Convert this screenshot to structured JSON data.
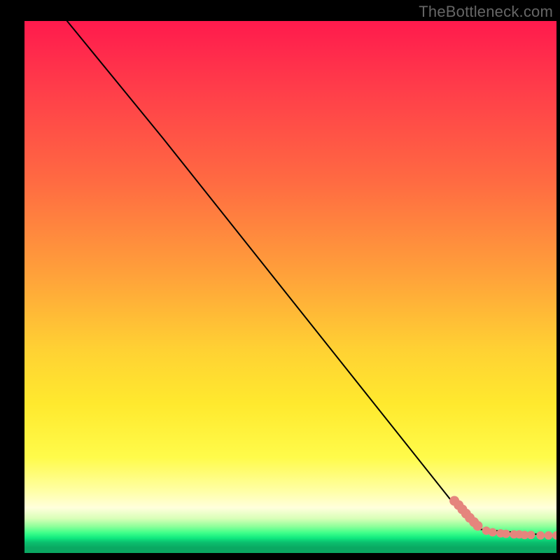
{
  "watermark": "TheBottleneck.com",
  "chart_data": {
    "type": "line",
    "title": "",
    "xlabel": "",
    "ylabel": "",
    "xlim": [
      0,
      100
    ],
    "ylim": [
      0,
      100
    ],
    "grid": false,
    "line": {
      "x": [
        8,
        26,
        80.5,
        85,
        100
      ],
      "y": [
        100,
        78,
        9.5,
        4.5,
        3.2
      ],
      "stroke": "#000000",
      "width": 2
    },
    "series": [
      {
        "name": "points-a",
        "type": "scatter",
        "color": "#e5857d",
        "radius": 7,
        "x": [
          80.8,
          81.6,
          82.3,
          83.0,
          83.7,
          84.5,
          85.2
        ],
        "y": [
          9.8,
          9.0,
          8.2,
          7.4,
          6.6,
          5.8,
          5.1
        ]
      },
      {
        "name": "points-b",
        "type": "scatter",
        "color": "#e5857d",
        "radius": 6,
        "x": [
          86.8,
          88.0,
          89.5,
          90.5,
          92.0,
          93.0,
          94.0,
          95.2,
          97.0,
          98.5,
          100.0
        ],
        "y": [
          4.2,
          3.9,
          3.7,
          3.6,
          3.5,
          3.5,
          3.4,
          3.4,
          3.3,
          3.3,
          3.3
        ]
      }
    ]
  },
  "colors": {
    "watermark": "#666666",
    "line": "#000000",
    "point": "#e5857d",
    "frame_bg": "#000000"
  }
}
